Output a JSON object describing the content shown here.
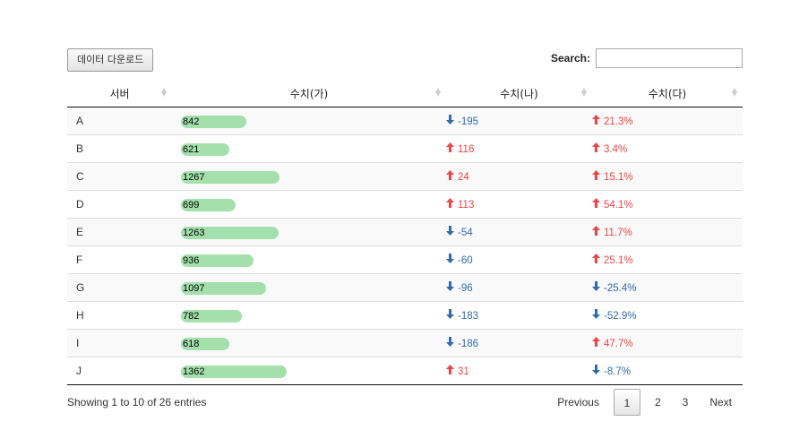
{
  "toolbar": {
    "download_label": "데이터 다운로드"
  },
  "search": {
    "label": "Search:",
    "value": ""
  },
  "columns": [
    "서버",
    "수치(가)",
    "수치(나)",
    "수치(다)"
  ],
  "rows": [
    {
      "server": "A",
      "ga": 842,
      "na": "-195",
      "na_dir": "down",
      "da": "21.3%",
      "da_dir": "up"
    },
    {
      "server": "B",
      "ga": 621,
      "na": "116",
      "na_dir": "up",
      "da": "3.4%",
      "da_dir": "up"
    },
    {
      "server": "C",
      "ga": 1267,
      "na": "24",
      "na_dir": "up",
      "da": "15.1%",
      "da_dir": "up"
    },
    {
      "server": "D",
      "ga": 699,
      "na": "113",
      "na_dir": "up",
      "da": "54.1%",
      "da_dir": "up"
    },
    {
      "server": "E",
      "ga": 1263,
      "na": "-54",
      "na_dir": "down",
      "da": "11.7%",
      "da_dir": "up"
    },
    {
      "server": "F",
      "ga": 936,
      "na": "-60",
      "na_dir": "down",
      "da": "25.1%",
      "da_dir": "up"
    },
    {
      "server": "G",
      "ga": 1097,
      "na": "-96",
      "na_dir": "down",
      "da": "-25.4%",
      "da_dir": "down"
    },
    {
      "server": "H",
      "ga": 782,
      "na": "-183",
      "na_dir": "down",
      "da": "-52.9%",
      "da_dir": "down"
    },
    {
      "server": "I",
      "ga": 618,
      "na": "-186",
      "na_dir": "down",
      "da": "47.7%",
      "da_dir": "up"
    },
    {
      "server": "J",
      "ga": 1362,
      "na": "31",
      "na_dir": "up",
      "da": "-8.7%",
      "da_dir": "down"
    }
  ],
  "bar_max": 1362,
  "colors": {
    "bar": "#a3e0ab",
    "up": "#ef4444",
    "down": "#2f6bb0"
  },
  "footer": {
    "info": "Showing 1 to 10 of 26 entries",
    "previous": "Previous",
    "pages": [
      "1",
      "2",
      "3"
    ],
    "current_page": "1",
    "next": "Next"
  }
}
